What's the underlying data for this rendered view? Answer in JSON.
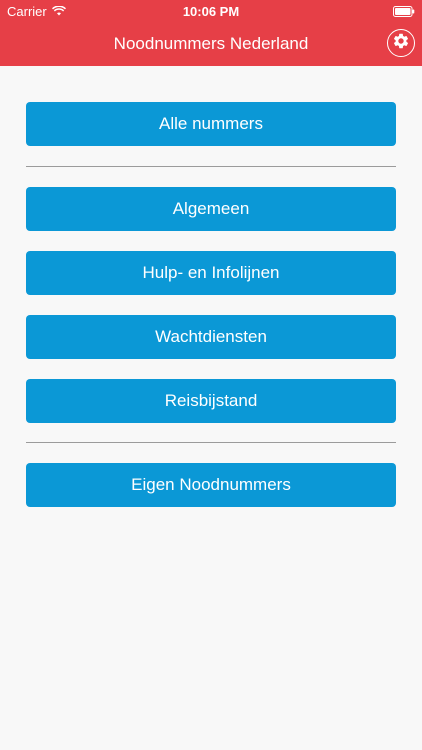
{
  "status_bar": {
    "carrier": "Carrier",
    "time": "10:06 PM",
    "wifi_icon": "wifi-icon",
    "battery_icon": "battery-icon"
  },
  "header": {
    "title": "Noodnummers Nederland",
    "settings_icon": "gear-icon",
    "color": "#e63f47"
  },
  "menu": {
    "all_numbers": "Alle nummers",
    "categories": [
      "Algemeen",
      "Hulp- en Infolijnen",
      "Wachtdiensten",
      "Reisbijstand"
    ],
    "own_numbers": "Eigen Noodnummers",
    "button_color": "#0b98d6"
  }
}
